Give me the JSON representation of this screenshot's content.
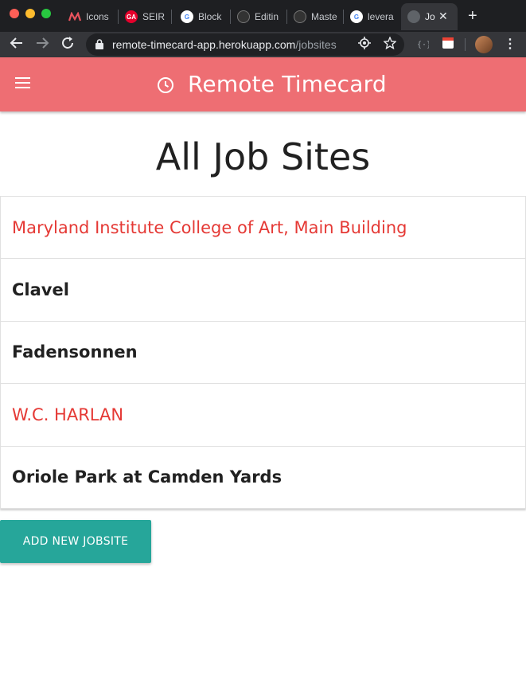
{
  "browser": {
    "tabs": [
      {
        "label": "Icons",
        "icon": "materialize-icon",
        "color": "#e8535d"
      },
      {
        "label": "SEIR E",
        "icon": "ga-icon",
        "color": "#e4002b"
      },
      {
        "label": "Block",
        "icon": "google-icon",
        "color": "#ffffff"
      },
      {
        "label": "Editin",
        "icon": "github-icon",
        "color": "#333333"
      },
      {
        "label": "Maste",
        "icon": "github-icon",
        "color": "#333333"
      },
      {
        "label": "levera",
        "icon": "google-icon",
        "color": "#ffffff"
      },
      {
        "label": "Jo",
        "icon": "globe-icon",
        "color": "#5f6368",
        "active": true
      }
    ],
    "close_symbol": "✕",
    "new_tab_symbol": "+",
    "url_host": "remote-timecard-app.herokuapp.com",
    "url_path": "/jobsites"
  },
  "app": {
    "title": "Remote Timecard",
    "header_color": "#ee6e73"
  },
  "page": {
    "title": "All Job Sites",
    "jobsites": [
      {
        "name": "Maryland Institute College of Art, Main Building",
        "style": "link"
      },
      {
        "name": "Clavel",
        "style": "plain"
      },
      {
        "name": "Fadensonnen",
        "style": "plain"
      },
      {
        "name": "W.C. HARLAN",
        "style": "link"
      },
      {
        "name": "Oriole Park at Camden Yards",
        "style": "plain"
      }
    ],
    "add_button_label": "ADD NEW JOBSITE",
    "add_button_color": "#26a69a",
    "link_color": "#e53935"
  }
}
